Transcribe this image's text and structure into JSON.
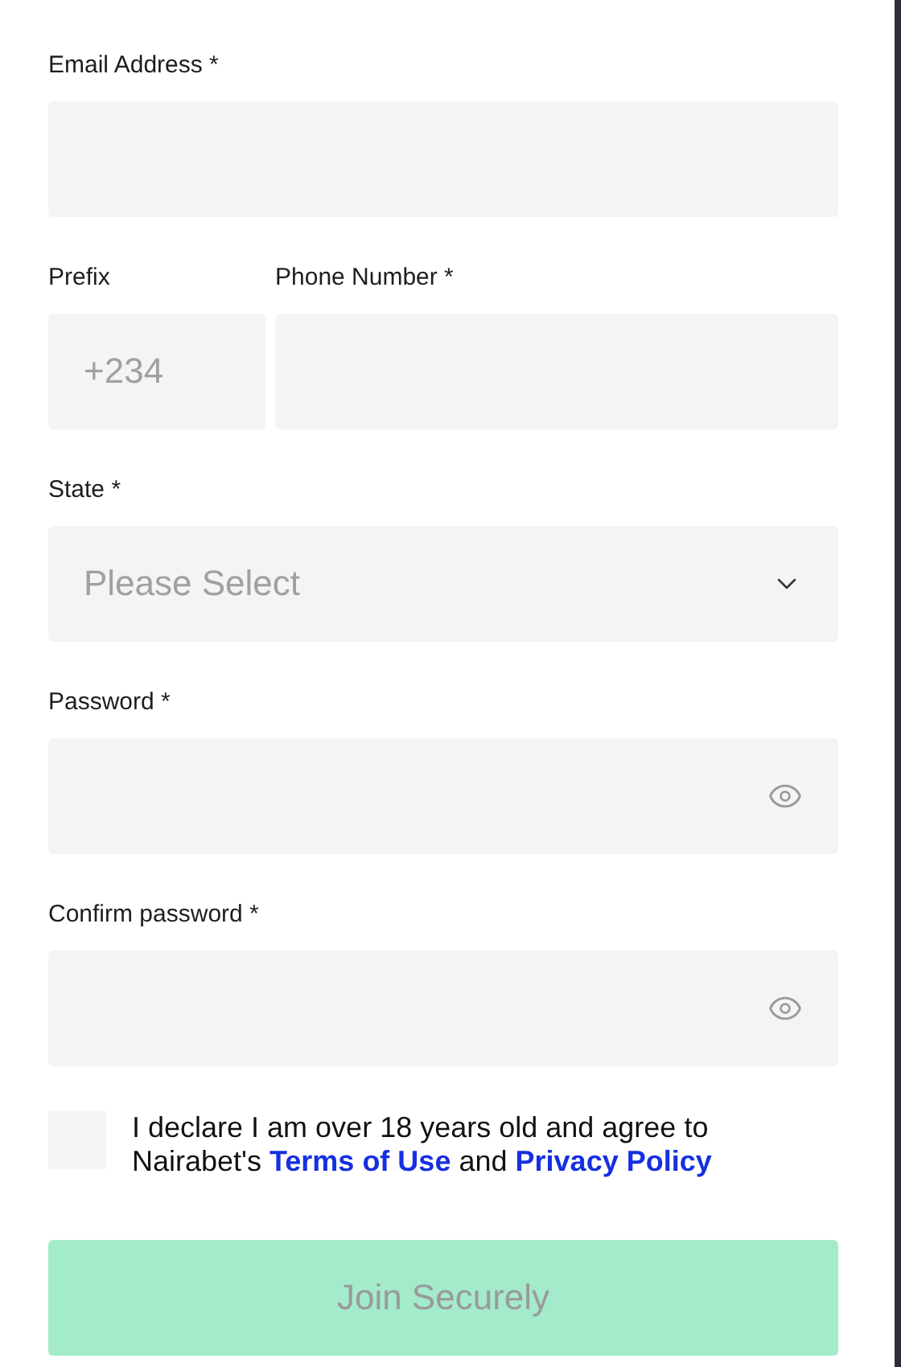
{
  "fields": [
    {
      "kind": "text",
      "label": "Email Address *"
    },
    {
      "kind": "phone",
      "prefix_label": "Prefix",
      "prefix_placeholder": "+234",
      "label": "Phone Number *"
    },
    {
      "kind": "select",
      "label": "State *",
      "placeholder": "Please Select"
    },
    {
      "kind": "password",
      "label": "Password *"
    },
    {
      "kind": "password",
      "label": "Confirm password *"
    }
  ],
  "consent": {
    "checked": false,
    "segments": [
      {
        "kind": "text",
        "text": "I declare I am over 18 years old and agree to Nairabet's"
      },
      {
        "kind": "link",
        "text": "Terms of Use"
      },
      {
        "kind": "text",
        "text": "and"
      },
      {
        "kind": "link",
        "text": "Privacy Policy"
      }
    ]
  },
  "submit": {
    "label": "Join Securely",
    "disabled": true
  }
}
